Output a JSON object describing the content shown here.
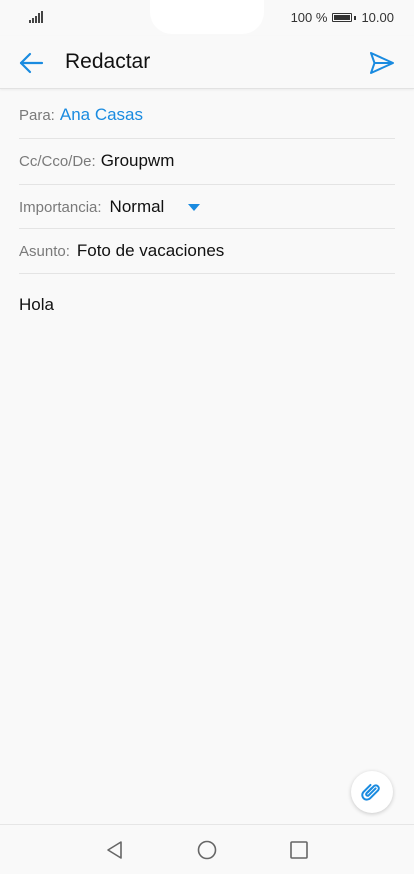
{
  "status_bar": {
    "battery_percent": "100 %",
    "battery_level": 1.0,
    "time": "10.00"
  },
  "app_bar": {
    "title": "Redactar",
    "back_icon": "back-arrow-icon",
    "send_icon": "send-icon"
  },
  "fields": {
    "to": {
      "label": "Para:",
      "value": "Ana Casas"
    },
    "cc": {
      "label": "Cc/Cco/De:",
      "value": "Groupwm"
    },
    "importance": {
      "label": "Importancia:",
      "value": "Normal",
      "icon": "dropdown-caret-icon"
    },
    "subject": {
      "label": "Asunto:",
      "value": "Foto de vacaciones"
    }
  },
  "body": {
    "text": "Hola"
  },
  "attach": {
    "icon": "paperclip-icon"
  },
  "nav": {
    "back_icon": "nav-back-icon",
    "home_icon": "nav-home-icon",
    "recents_icon": "nav-recents-icon"
  },
  "colors": {
    "accent": "#1a8be0",
    "background": "#f9f9f9",
    "label": "#7a7a7a"
  }
}
